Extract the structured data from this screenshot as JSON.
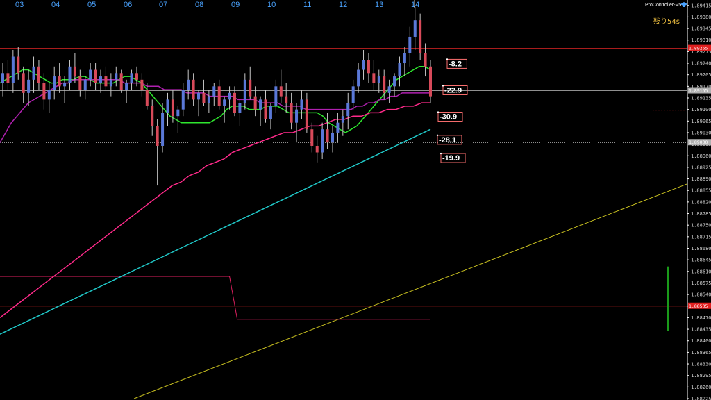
{
  "header": {
    "indicator": "ProController-V5",
    "remaining": "残り54s"
  },
  "chart_data": {
    "type": "candlestick",
    "x_ticks": [
      "03",
      "04",
      "05",
      "06",
      "07",
      "08",
      "09",
      "10",
      "11",
      "12",
      "13",
      "14"
    ],
    "y_ticks": [
      "1.89415",
      "1.89380",
      "1.89345",
      "1.89310",
      "1.89275",
      "1.89240",
      "1.89205",
      "1.89170",
      "1.89135",
      "1.89100",
      "1.89065",
      "1.89030",
      "1.88995",
      "1.88960",
      "1.88925",
      "1.88890",
      "1.88855",
      "1.88820",
      "1.88785",
      "1.88750",
      "1.88715",
      "1.88680",
      "1.88645",
      "1.88610",
      "1.88575",
      "1.88540",
      "1.88505",
      "1.88470",
      "1.88435",
      "1.88400",
      "1.88365",
      "1.88330",
      "1.88295",
      "1.88260",
      "1.88225"
    ],
    "y_range": [
      1.88225,
      1.89425
    ],
    "labels": [
      {
        "text": "-8.2",
        "value": 1.89235
      },
      {
        "text": "-22.9",
        "value": 1.89155
      },
      {
        "text": "-30.9",
        "value": 1.89075
      },
      {
        "text": "-28.1",
        "value": 1.89005
      },
      {
        "text": "-19.9",
        "value": 1.8895
      }
    ],
    "price_tags": [
      {
        "text": "1.89255",
        "value": 1.89285,
        "color": "#e02020"
      },
      {
        "text": "1.89155",
        "value": 1.89157,
        "color": "#b0b0b0"
      },
      {
        "text": "1.89000",
        "value": 1.89,
        "color": "#b0b0b0"
      },
      {
        "text": "1.88505",
        "value": 1.88505,
        "color": "#e02020"
      }
    ],
    "hlines": [
      {
        "value": 1.89285,
        "color": "#c02020",
        "style": "solid"
      },
      {
        "value": 1.89157,
        "color": "#909090",
        "style": "solid"
      },
      {
        "value": 1.89,
        "color": "#c0c0c0",
        "style": "dotted"
      },
      {
        "value": 1.88505,
        "color": "#c02020",
        "style": "solid"
      }
    ],
    "candles": [
      [
        1.8918,
        1.8924,
        1.8914,
        1.8921
      ],
      [
        1.8921,
        1.8925,
        1.8916,
        1.8918
      ],
      [
        1.8918,
        1.8928,
        1.8915,
        1.8926
      ],
      [
        1.8926,
        1.8929,
        1.8919,
        1.8921
      ],
      [
        1.8921,
        1.8923,
        1.8912,
        1.8915
      ],
      [
        1.8915,
        1.8922,
        1.8911,
        1.8919
      ],
      [
        1.8919,
        1.8926,
        1.8915,
        1.8923
      ],
      [
        1.8923,
        1.8925,
        1.8916,
        1.8918
      ],
      [
        1.8918,
        1.8921,
        1.891,
        1.8913
      ],
      [
        1.8913,
        1.8918,
        1.8909,
        1.8916
      ],
      [
        1.8916,
        1.8923,
        1.8913,
        1.892
      ],
      [
        1.892,
        1.8924,
        1.8915,
        1.8917
      ],
      [
        1.8917,
        1.892,
        1.8912,
        1.8918
      ],
      [
        1.8918,
        1.8925,
        1.8916,
        1.8923
      ],
      [
        1.8923,
        1.8927,
        1.8918,
        1.892
      ],
      [
        1.892,
        1.8922,
        1.8914,
        1.8916
      ],
      [
        1.8916,
        1.892,
        1.8913,
        1.8919
      ],
      [
        1.8919,
        1.8924,
        1.8917,
        1.8922
      ],
      [
        1.8922,
        1.8924,
        1.8916,
        1.8918
      ],
      [
        1.8918,
        1.8922,
        1.8915,
        1.892
      ],
      [
        1.892,
        1.8923,
        1.8916,
        1.8917
      ],
      [
        1.8917,
        1.8921,
        1.8914,
        1.8919
      ],
      [
        1.8919,
        1.8923,
        1.8917,
        1.8921
      ],
      [
        1.8921,
        1.8922,
        1.8915,
        1.8916
      ],
      [
        1.8916,
        1.8919,
        1.8912,
        1.8918
      ],
      [
        1.8918,
        1.8922,
        1.8916,
        1.8921
      ],
      [
        1.8921,
        1.8923,
        1.8917,
        1.8919
      ],
      [
        1.8919,
        1.8921,
        1.8914,
        1.8916
      ],
      [
        1.8916,
        1.8918,
        1.891,
        1.8911
      ],
      [
        1.8911,
        1.8913,
        1.8902,
        1.8905
      ],
      [
        1.8905,
        1.8907,
        1.8887,
        1.8899
      ],
      [
        1.8899,
        1.8912,
        1.8897,
        1.8909
      ],
      [
        1.8909,
        1.8915,
        1.8905,
        1.8913
      ],
      [
        1.8913,
        1.8916,
        1.8906,
        1.8908
      ],
      [
        1.8908,
        1.8911,
        1.8903,
        1.891
      ],
      [
        1.891,
        1.8918,
        1.8908,
        1.8916
      ],
      [
        1.8916,
        1.8922,
        1.8913,
        1.8919
      ],
      [
        1.8919,
        1.8921,
        1.8911,
        1.8913
      ],
      [
        1.8913,
        1.8916,
        1.8908,
        1.8915
      ],
      [
        1.8915,
        1.8919,
        1.8911,
        1.8912
      ],
      [
        1.8912,
        1.8916,
        1.8909,
        1.8914
      ],
      [
        1.8914,
        1.8918,
        1.8911,
        1.8917
      ],
      [
        1.8917,
        1.8919,
        1.891,
        1.8911
      ],
      [
        1.8911,
        1.8914,
        1.8906,
        1.8913
      ],
      [
        1.8913,
        1.8917,
        1.891,
        1.8915
      ],
      [
        1.8915,
        1.8917,
        1.8908,
        1.8909
      ],
      [
        1.8909,
        1.8913,
        1.8905,
        1.8912
      ],
      [
        1.8912,
        1.8921,
        1.891,
        1.8919
      ],
      [
        1.8919,
        1.8923,
        1.8913,
        1.8914
      ],
      [
        1.8914,
        1.8917,
        1.8908,
        1.891
      ],
      [
        1.891,
        1.8914,
        1.8905,
        1.8913
      ],
      [
        1.8913,
        1.8916,
        1.8906,
        1.8907
      ],
      [
        1.8907,
        1.8912,
        1.8904,
        1.8911
      ],
      [
        1.8911,
        1.8919,
        1.8909,
        1.8917
      ],
      [
        1.8917,
        1.8922,
        1.8912,
        1.8914
      ],
      [
        1.8914,
        1.8918,
        1.8909,
        1.8912
      ],
      [
        1.8912,
        1.8915,
        1.8904,
        1.8906
      ],
      [
        1.8906,
        1.8912,
        1.89,
        1.891
      ],
      [
        1.891,
        1.8916,
        1.8907,
        1.8913
      ],
      [
        1.8913,
        1.8915,
        1.8903,
        1.8904
      ],
      [
        1.8904,
        1.8906,
        1.8897,
        1.8899
      ],
      [
        1.8899,
        1.8902,
        1.8894,
        1.8897
      ],
      [
        1.8897,
        1.8906,
        1.8895,
        1.8904
      ],
      [
        1.8904,
        1.8909,
        1.8898,
        1.89
      ],
      [
        1.89,
        1.8905,
        1.8897,
        1.8903
      ],
      [
        1.8903,
        1.8909,
        1.89,
        1.8906
      ],
      [
        1.8906,
        1.891,
        1.8902,
        1.8908
      ],
      [
        1.8908,
        1.8915,
        1.8904,
        1.8912
      ],
      [
        1.8912,
        1.8919,
        1.891,
        1.8917
      ],
      [
        1.8917,
        1.8924,
        1.8915,
        1.8922
      ],
      [
        1.8922,
        1.8928,
        1.8919,
        1.8925
      ],
      [
        1.8925,
        1.8927,
        1.8918,
        1.8921
      ],
      [
        1.8921,
        1.8925,
        1.8916,
        1.8918
      ],
      [
        1.8918,
        1.8922,
        1.8915,
        1.892
      ],
      [
        1.892,
        1.8922,
        1.8913,
        1.8915
      ],
      [
        1.8915,
        1.8919,
        1.8912,
        1.8917
      ],
      [
        1.8917,
        1.8921,
        1.8914,
        1.892
      ],
      [
        1.892,
        1.8926,
        1.8917,
        1.8924
      ],
      [
        1.8924,
        1.8929,
        1.892,
        1.8927
      ],
      [
        1.8927,
        1.8935,
        1.8923,
        1.8932
      ],
      [
        1.8932,
        1.8941,
        1.8928,
        1.8937
      ],
      [
        1.8937,
        1.8939,
        1.8925,
        1.8927
      ],
      [
        1.8927,
        1.893,
        1.892,
        1.8923
      ],
      [
        1.8923,
        1.8925,
        1.8912,
        1.8914
      ]
    ],
    "series": [
      {
        "key": "sma_fast",
        "color": "#2ee62e",
        "width": 1.5,
        "values": [
          1.8918,
          1.8919,
          1.892,
          1.8921,
          1.8922,
          1.8922,
          1.8921,
          1.892,
          1.8919,
          1.8918,
          1.8918,
          1.8919,
          1.8919,
          1.8919,
          1.892,
          1.892,
          1.8919,
          1.8918,
          1.8918,
          1.8918,
          1.8918,
          1.8919,
          1.892,
          1.892,
          1.8919,
          1.8918,
          1.8916,
          1.8914,
          1.8912,
          1.891,
          1.8908,
          1.8907,
          1.8906,
          1.8906,
          1.8906,
          1.8906,
          1.8906,
          1.8906,
          1.8907,
          1.8908,
          1.891,
          1.8911,
          1.8911,
          1.8911,
          1.891,
          1.891,
          1.891,
          1.8911,
          1.8911,
          1.8911,
          1.891,
          1.8909,
          1.8909,
          1.8909,
          1.8909,
          1.8909,
          1.8909,
          1.8908,
          1.8906,
          1.8905,
          1.8904,
          1.8903,
          1.8904,
          1.8905,
          1.8907,
          1.8909,
          1.8911,
          1.8913,
          1.8915,
          1.8917,
          1.8919,
          1.892,
          1.8921,
          1.8922,
          1.8923,
          1.8923,
          1.8922
        ]
      },
      {
        "key": "sma_mid",
        "color": "#b020b0",
        "width": 1.5,
        "values": [
          1.89,
          1.8903,
          1.8906,
          1.8908,
          1.891,
          1.8912,
          1.8913,
          1.8914,
          1.8915,
          1.8916,
          1.8917,
          1.8918,
          1.8918,
          1.8919,
          1.8919,
          1.8919,
          1.8919,
          1.8919,
          1.8919,
          1.8919,
          1.8919,
          1.8919,
          1.8918,
          1.8918,
          1.8918,
          1.8918,
          1.8917,
          1.8917,
          1.8917,
          1.8916,
          1.8916,
          1.8916,
          1.8916,
          1.8915,
          1.8915,
          1.8915,
          1.8915,
          1.8914,
          1.8914,
          1.8914,
          1.8914,
          1.8914,
          1.8913,
          1.8913,
          1.8913,
          1.8913,
          1.8912,
          1.8912,
          1.8912,
          1.8912,
          1.8911,
          1.8911,
          1.8911,
          1.8911,
          1.891,
          1.891,
          1.891,
          1.891,
          1.891,
          1.891,
          1.891,
          1.891,
          1.891,
          1.8911,
          1.8911,
          1.8912,
          1.8912,
          1.8913,
          1.8913,
          1.8914,
          1.8914,
          1.8915,
          1.8915,
          1.8915,
          1.8915,
          1.8915,
          1.8915
        ]
      },
      {
        "key": "sma_slow",
        "color": "#ff2a8a",
        "width": 1.5,
        "values": [
          1.8847,
          1.8849,
          1.8851,
          1.8853,
          1.8855,
          1.8857,
          1.8859,
          1.8861,
          1.8863,
          1.8865,
          1.8867,
          1.8869,
          1.8871,
          1.8873,
          1.8875,
          1.8877,
          1.8879,
          1.8881,
          1.8883,
          1.8885,
          1.8887,
          1.8888,
          1.889,
          1.8891,
          1.8893,
          1.8894,
          1.8895,
          1.8897,
          1.8898,
          1.8899,
          1.89,
          1.8901,
          1.8902,
          1.8903,
          1.8903,
          1.8904,
          1.8905,
          1.8905,
          1.8906,
          1.8907,
          1.8907,
          1.8908,
          1.8908,
          1.8909,
          1.8909,
          1.891,
          1.891,
          1.8911,
          1.8911,
          1.8912,
          1.8912
        ]
      },
      {
        "key": "sma_long",
        "color": "#20c8c8",
        "width": 1.5,
        "values": [
          1.8842,
          1.8844,
          1.8846,
          1.8848,
          1.885,
          1.8852,
          1.8854,
          1.8856,
          1.8858,
          1.886,
          1.8862,
          1.8864,
          1.8866,
          1.8868,
          1.887,
          1.8872,
          1.8874,
          1.8876,
          1.8878,
          1.888,
          1.8882,
          1.8884,
          1.8886,
          1.8888,
          1.889,
          1.8892,
          1.8894,
          1.8896,
          1.8898,
          1.89,
          1.8902,
          1.8904
        ]
      }
    ],
    "trendline": {
      "from": [
        0.195,
        1.88225
      ],
      "to": [
        1.0,
        1.88875
      ],
      "color": "#c8c020"
    },
    "step_line": {
      "color": "#e02060",
      "level1": 1.88595,
      "level2": 1.88465
    },
    "bar_indicator": {
      "color": "#1a9a1a",
      "from": 1.88625,
      "to": 1.8843
    }
  }
}
